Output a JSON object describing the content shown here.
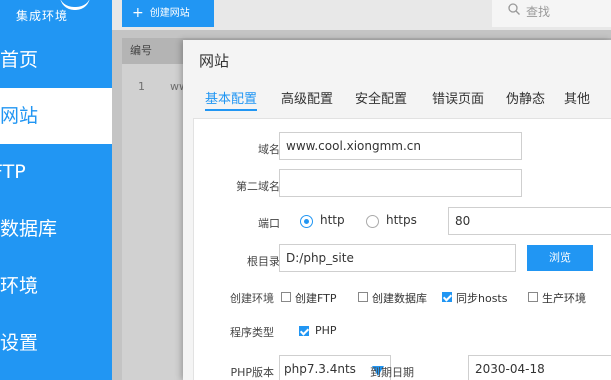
{
  "sidebar": {
    "logo_text": "集成环境",
    "items": [
      {
        "label": "首页"
      },
      {
        "label": "网站"
      },
      {
        "label": "FTP"
      },
      {
        "label": "数据库"
      },
      {
        "label": "环境"
      },
      {
        "label": "设置"
      }
    ],
    "active_index": 1
  },
  "topbar": {
    "create_label": "创建网站",
    "search_placeholder": "查找"
  },
  "table": {
    "header_num": "编号",
    "rows": [
      {
        "num": "1",
        "name": "ww"
      }
    ]
  },
  "modal": {
    "title": "网站",
    "tabs": [
      "基本配置",
      "高级配置",
      "安全配置",
      "错误页面",
      "伪静态",
      "其他"
    ],
    "active_tab": 0,
    "form": {
      "domain_label": "域名",
      "domain_value": "www.cool.xiongmm.cn",
      "second_domain_label": "第二域名",
      "second_domain_value": "",
      "port_label": "端口",
      "protocol_http": "http",
      "protocol_https": "https",
      "protocol_selected": "http",
      "port_value": "80",
      "root_label": "根目录",
      "root_value": "D:/php_site",
      "browse_label": "浏览",
      "env_label": "创建环境",
      "env_options": [
        {
          "label": "创建FTP",
          "checked": false
        },
        {
          "label": "创建数据库",
          "checked": false
        },
        {
          "label": "同步hosts",
          "checked": true
        },
        {
          "label": "生产环境",
          "checked": false
        }
      ],
      "program_label": "程序类型",
      "program_php": "PHP",
      "program_php_checked": true,
      "php_version_label": "PHP版本",
      "php_version_value": "php7.3.4nts",
      "expire_label": "到期日期",
      "expire_value": "2030-04-18"
    }
  },
  "colors": {
    "accent": "#2196f3"
  }
}
